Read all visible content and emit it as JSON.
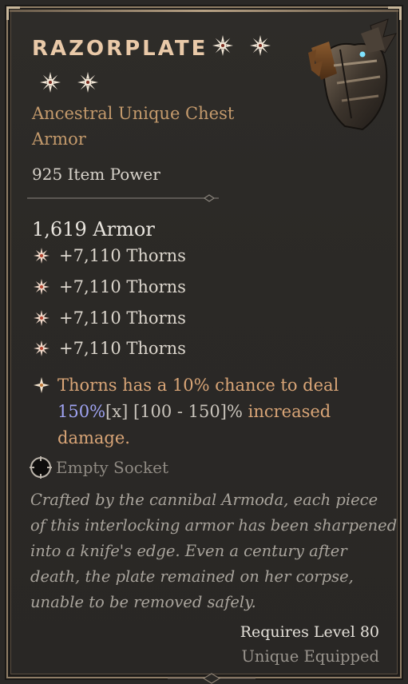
{
  "item": {
    "name": "RAZORPLATE",
    "type_line_1": "Ancestral Unique Chest",
    "type_line_2": "Armor",
    "item_power": "925 Item Power",
    "base_stat": "1,619 Armor",
    "rarity_stars": 4,
    "image": "chest-armor-icon"
  },
  "affixes": [
    {
      "text": "+7,110 Thorns",
      "icon": "thorns-star-icon"
    },
    {
      "text": "+7,110 Thorns",
      "icon": "thorns-star-icon"
    },
    {
      "text": "+7,110 Thorns",
      "icon": "thorns-star-icon"
    },
    {
      "text": "+7,110 Thorns",
      "icon": "thorns-star-icon"
    }
  ],
  "unique_power": {
    "prefix": "Thorns has a 10% chance to deal",
    "value": "150%",
    "bracket_x": "[x]",
    "range": " [100 - 150]%",
    "suffix": " increased",
    "line3": "damage.",
    "icon": "unique-power-icon"
  },
  "socket": {
    "label": "Empty Socket",
    "icon": "socket-icon"
  },
  "flavor_text": "Crafted by the cannibal Armoda, each piece of this interlocking armor has been sharpened into a knife's edge. Even a century after death, the plate remained on her corpse, unable to be removed safely.",
  "requirements": {
    "level": "Requires Level 80",
    "equip": "Unique Equipped"
  },
  "colors": {
    "title": "#e9c9a8",
    "type": "#c49a6c",
    "unique_affix": "#d9a577",
    "value_blue": "#9fa3f2",
    "flavor": "#a9a49c",
    "border": "#8f7d66"
  }
}
